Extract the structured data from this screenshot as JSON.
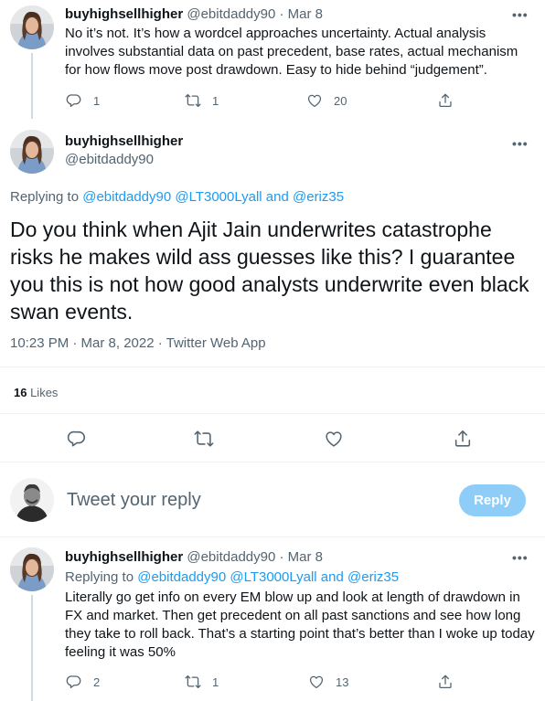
{
  "tweet1": {
    "name": "buyhighsellhigher",
    "handle": "@ebitdaddy90",
    "sep": "·",
    "date": "Mar 8",
    "more": "•••",
    "text": "No it’s not. It’s how a wordcel approaches uncertainty. Actual analysis involves substantial data on past precedent, base rates, actual mechanism for how flows move post drawdown. Easy to hide behind “judgement”.",
    "replies": "1",
    "retweets": "1",
    "likes": "20"
  },
  "main": {
    "name": "buyhighsellhigher",
    "handle": "@ebitdaddy90",
    "more": "•••",
    "replying_prefix": "Replying to ",
    "replying_to": "@ebitdaddy90 @LT3000Lyall and @eriz35",
    "text": "Do you think when Ajit Jain underwrites catastrophe risks he makes wild ass guesses like this? I guarantee you this is not how good analysts underwrite even black swan events.",
    "meta": "10:23 PM · Mar 8, 2022 · Twitter Web App",
    "likes_count": "16",
    "likes_label": " Likes"
  },
  "composer": {
    "placeholder": "Tweet your reply",
    "button": "Reply"
  },
  "tweet2": {
    "name": "buyhighsellhigher",
    "handle": "@ebitdaddy90",
    "sep": "·",
    "date": "Mar 8",
    "more": "•••",
    "replying_prefix": "Replying to ",
    "replying_to": "@ebitdaddy90 @LT3000Lyall and @eriz35",
    "text": "Literally go get info on every EM blow up and look at length of drawdown in FX and market. Then get precedent on all past sanctions and see how long they take to roll back. That’s a starting point that’s better than I woke up today feeling it was 50%",
    "replies": "2",
    "retweets": "1",
    "likes": "13"
  },
  "icons": {
    "reply": "reply-icon",
    "retweet": "retweet-icon",
    "like": "heart-icon",
    "share": "share-icon"
  },
  "colors": {
    "accent": "#1d9bf0",
    "reply_button": "#8ecdf7",
    "muted": "#536471"
  }
}
